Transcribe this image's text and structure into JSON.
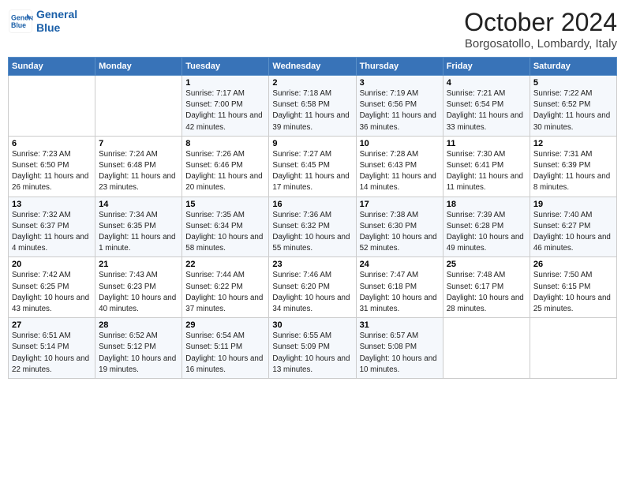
{
  "header": {
    "logo_line1": "General",
    "logo_line2": "Blue",
    "month": "October 2024",
    "location": "Borgosatollo, Lombardy, Italy"
  },
  "days_of_week": [
    "Sunday",
    "Monday",
    "Tuesday",
    "Wednesday",
    "Thursday",
    "Friday",
    "Saturday"
  ],
  "weeks": [
    [
      {
        "day": "",
        "info": ""
      },
      {
        "day": "",
        "info": ""
      },
      {
        "day": "1",
        "info": "Sunrise: 7:17 AM\nSunset: 7:00 PM\nDaylight: 11 hours and 42 minutes."
      },
      {
        "day": "2",
        "info": "Sunrise: 7:18 AM\nSunset: 6:58 PM\nDaylight: 11 hours and 39 minutes."
      },
      {
        "day": "3",
        "info": "Sunrise: 7:19 AM\nSunset: 6:56 PM\nDaylight: 11 hours and 36 minutes."
      },
      {
        "day": "4",
        "info": "Sunrise: 7:21 AM\nSunset: 6:54 PM\nDaylight: 11 hours and 33 minutes."
      },
      {
        "day": "5",
        "info": "Sunrise: 7:22 AM\nSunset: 6:52 PM\nDaylight: 11 hours and 30 minutes."
      }
    ],
    [
      {
        "day": "6",
        "info": "Sunrise: 7:23 AM\nSunset: 6:50 PM\nDaylight: 11 hours and 26 minutes."
      },
      {
        "day": "7",
        "info": "Sunrise: 7:24 AM\nSunset: 6:48 PM\nDaylight: 11 hours and 23 minutes."
      },
      {
        "day": "8",
        "info": "Sunrise: 7:26 AM\nSunset: 6:46 PM\nDaylight: 11 hours and 20 minutes."
      },
      {
        "day": "9",
        "info": "Sunrise: 7:27 AM\nSunset: 6:45 PM\nDaylight: 11 hours and 17 minutes."
      },
      {
        "day": "10",
        "info": "Sunrise: 7:28 AM\nSunset: 6:43 PM\nDaylight: 11 hours and 14 minutes."
      },
      {
        "day": "11",
        "info": "Sunrise: 7:30 AM\nSunset: 6:41 PM\nDaylight: 11 hours and 11 minutes."
      },
      {
        "day": "12",
        "info": "Sunrise: 7:31 AM\nSunset: 6:39 PM\nDaylight: 11 hours and 8 minutes."
      }
    ],
    [
      {
        "day": "13",
        "info": "Sunrise: 7:32 AM\nSunset: 6:37 PM\nDaylight: 11 hours and 4 minutes."
      },
      {
        "day": "14",
        "info": "Sunrise: 7:34 AM\nSunset: 6:35 PM\nDaylight: 11 hours and 1 minute."
      },
      {
        "day": "15",
        "info": "Sunrise: 7:35 AM\nSunset: 6:34 PM\nDaylight: 10 hours and 58 minutes."
      },
      {
        "day": "16",
        "info": "Sunrise: 7:36 AM\nSunset: 6:32 PM\nDaylight: 10 hours and 55 minutes."
      },
      {
        "day": "17",
        "info": "Sunrise: 7:38 AM\nSunset: 6:30 PM\nDaylight: 10 hours and 52 minutes."
      },
      {
        "day": "18",
        "info": "Sunrise: 7:39 AM\nSunset: 6:28 PM\nDaylight: 10 hours and 49 minutes."
      },
      {
        "day": "19",
        "info": "Sunrise: 7:40 AM\nSunset: 6:27 PM\nDaylight: 10 hours and 46 minutes."
      }
    ],
    [
      {
        "day": "20",
        "info": "Sunrise: 7:42 AM\nSunset: 6:25 PM\nDaylight: 10 hours and 43 minutes."
      },
      {
        "day": "21",
        "info": "Sunrise: 7:43 AM\nSunset: 6:23 PM\nDaylight: 10 hours and 40 minutes."
      },
      {
        "day": "22",
        "info": "Sunrise: 7:44 AM\nSunset: 6:22 PM\nDaylight: 10 hours and 37 minutes."
      },
      {
        "day": "23",
        "info": "Sunrise: 7:46 AM\nSunset: 6:20 PM\nDaylight: 10 hours and 34 minutes."
      },
      {
        "day": "24",
        "info": "Sunrise: 7:47 AM\nSunset: 6:18 PM\nDaylight: 10 hours and 31 minutes."
      },
      {
        "day": "25",
        "info": "Sunrise: 7:48 AM\nSunset: 6:17 PM\nDaylight: 10 hours and 28 minutes."
      },
      {
        "day": "26",
        "info": "Sunrise: 7:50 AM\nSunset: 6:15 PM\nDaylight: 10 hours and 25 minutes."
      }
    ],
    [
      {
        "day": "27",
        "info": "Sunrise: 6:51 AM\nSunset: 5:14 PM\nDaylight: 10 hours and 22 minutes."
      },
      {
        "day": "28",
        "info": "Sunrise: 6:52 AM\nSunset: 5:12 PM\nDaylight: 10 hours and 19 minutes."
      },
      {
        "day": "29",
        "info": "Sunrise: 6:54 AM\nSunset: 5:11 PM\nDaylight: 10 hours and 16 minutes."
      },
      {
        "day": "30",
        "info": "Sunrise: 6:55 AM\nSunset: 5:09 PM\nDaylight: 10 hours and 13 minutes."
      },
      {
        "day": "31",
        "info": "Sunrise: 6:57 AM\nSunset: 5:08 PM\nDaylight: 10 hours and 10 minutes."
      },
      {
        "day": "",
        "info": ""
      },
      {
        "day": "",
        "info": ""
      }
    ]
  ]
}
